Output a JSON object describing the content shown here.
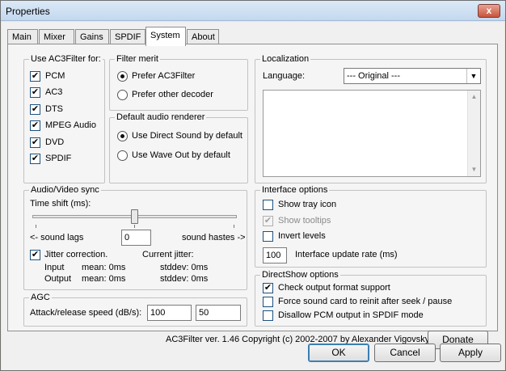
{
  "window": {
    "title": "Properties",
    "close_label": "x"
  },
  "tabs": [
    "Main",
    "Mixer",
    "Gains",
    "SPDIF",
    "System",
    "About"
  ],
  "use_ac3filter": {
    "title": "Use AC3Filter for:",
    "items": [
      {
        "label": "PCM",
        "checked": true
      },
      {
        "label": "AC3",
        "checked": true
      },
      {
        "label": "DTS",
        "checked": true
      },
      {
        "label": "MPEG Audio",
        "checked": true
      },
      {
        "label": "DVD",
        "checked": true
      },
      {
        "label": "SPDIF",
        "checked": true
      }
    ]
  },
  "filter_merit": {
    "title": "Filter merit",
    "options": [
      {
        "label": "Prefer AC3Filter",
        "selected": true
      },
      {
        "label": "Prefer other decoder",
        "selected": false
      }
    ]
  },
  "audio_renderer": {
    "title": "Default audio renderer",
    "options": [
      {
        "label": "Use Direct Sound by default",
        "selected": true
      },
      {
        "label": "Use Wave Out by default",
        "selected": false
      }
    ]
  },
  "localization": {
    "title": "Localization",
    "language_label": "Language:",
    "language_value": "--- Original ---"
  },
  "av_sync": {
    "title": "Audio/Video sync",
    "time_shift_label": "Time shift (ms):",
    "time_shift_value": "0",
    "left_label": "<- sound lags",
    "right_label": "sound hastes ->",
    "jitter_label": "Jitter correction.",
    "jitter_checked": true,
    "current_jitter_label": "Current jitter:",
    "input_label": "Input",
    "output_label": "Output",
    "input_mean": "mean: 0ms",
    "output_mean": "mean: 0ms",
    "input_stddev": "stddev: 0ms",
    "output_stddev": "stddev: 0ms"
  },
  "agc": {
    "title": "AGC",
    "label": "Attack/release speed (dB/s):",
    "attack": "100",
    "release": "50"
  },
  "interface_options": {
    "title": "Interface options",
    "items": [
      {
        "label": "Show tray icon",
        "checked": false,
        "disabled": false
      },
      {
        "label": "Show tooltips",
        "checked": true,
        "disabled": true
      },
      {
        "label": "Invert levels",
        "checked": false,
        "disabled": false
      }
    ],
    "update_rate_value": "100",
    "update_rate_label": "Interface update rate (ms)"
  },
  "directshow_options": {
    "title": "DirectShow options",
    "items": [
      {
        "label": "Check output format support",
        "checked": true
      },
      {
        "label": "Force sound card to reinit after seek / pause",
        "checked": false
      },
      {
        "label": "Disallow PCM output in SPDIF mode",
        "checked": false
      }
    ]
  },
  "footer": {
    "copyright": "AC3Filter ver. 1.46 Copyright (c) 2002-2007 by Alexander Vigovsky",
    "donate": "Donate"
  },
  "buttons": {
    "ok": "OK",
    "cancel": "Cancel",
    "apply": "Apply"
  }
}
